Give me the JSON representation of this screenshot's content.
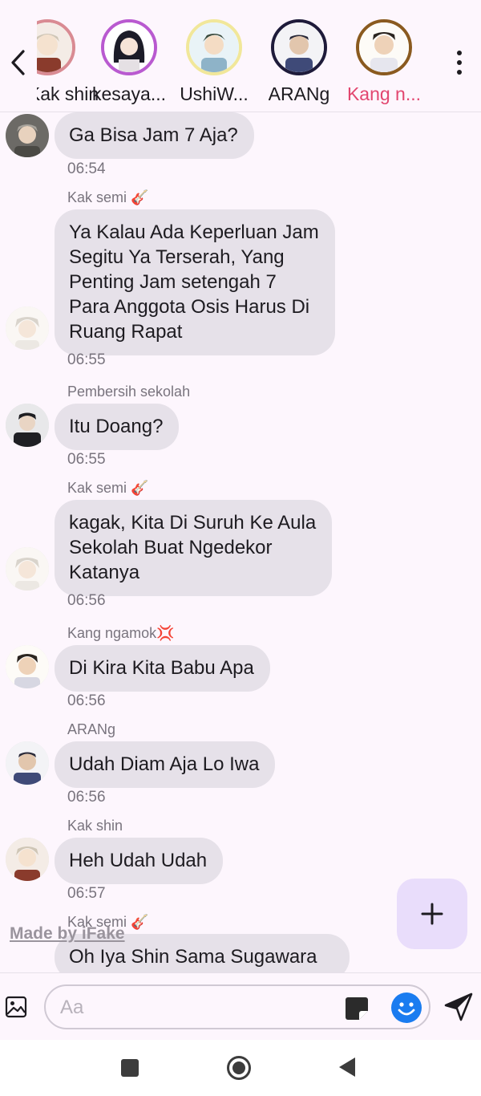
{
  "header": {
    "members": [
      {
        "name": "Kak shin",
        "ring_color": "#d98b93",
        "active": false
      },
      {
        "name": "kesaya...",
        "ring_color": "#b95ad0",
        "active": false
      },
      {
        "name": "UshiW...",
        "ring_color": "#f1e79a",
        "active": false
      },
      {
        "name": "ARANg",
        "ring_color": "#1e1b3a",
        "active": false
      },
      {
        "name": "Kang n...",
        "ring_color": "#8a5a1f",
        "active": true
      }
    ],
    "back_icon": "chevron-left-icon",
    "more_icon": "more-vertical-icon"
  },
  "messages": [
    {
      "sender": "",
      "text": "Ga Bisa Jam 7 Aja?",
      "time": "06:54",
      "avatar": "grey-hair-boy"
    },
    {
      "sender": "Kak semi 🎸",
      "text": "Ya Kalau Ada Keperluan Jam\nSegitu Ya Terserah, Yang\nPenting Jam setengah 7\nPara Anggota Osis Harus Di\nRuang Rapat",
      "time": "06:55",
      "avatar": "white-hair-boy"
    },
    {
      "sender": "Pembersih sekolah",
      "text": "Itu Doang?",
      "time": "06:55",
      "avatar": "dark-hair-boy"
    },
    {
      "sender": "Kak semi 🎸",
      "text": "kagak, Kita Di Suruh Ke Aula\nSekolah Buat Ngedekor\nKatanya",
      "time": "06:56",
      "avatar": "white-hair-boy"
    },
    {
      "sender": "Kang ngamok💢",
      "text": "Di Kira Kita Babu Apa",
      "time": "06:56",
      "avatar": "brown-hair-boy"
    },
    {
      "sender": "ARANg",
      "text": "Udah Diam Aja Lo Iwa",
      "time": "06:56",
      "avatar": "buzzcut-boy"
    },
    {
      "sender": "Kak shin",
      "text": "Heh Udah Udah",
      "time": "06:57",
      "avatar": "blonde-boy"
    },
    {
      "sender": "Kak semi 🎸",
      "text": "Oh Iya Shin Sama Sugawara",
      "time": "",
      "avatar": ""
    }
  ],
  "watermark": "Made by iFake",
  "composer": {
    "placeholder": "Aa",
    "value": ""
  },
  "colors": {
    "accent": "#e2466f",
    "bubble": "#e6e1e9",
    "background": "#fdf6fd",
    "fab": "#e9ddfb",
    "emoji": "#1a7cf0"
  }
}
